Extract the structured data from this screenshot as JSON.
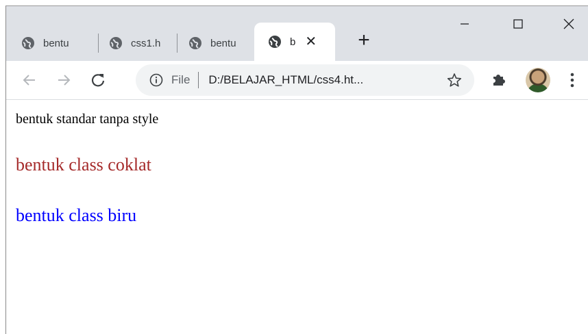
{
  "browser": {
    "tabs": [
      {
        "title": "bentu"
      },
      {
        "title": "css1.h"
      },
      {
        "title": "bentu"
      },
      {
        "title": "b",
        "active": true
      }
    ],
    "new_tab_symbol": "+",
    "close_tab_symbol": "✕",
    "window_controls": {
      "minimize_icon": "minimize-icon",
      "maximize_icon": "maximize-icon",
      "close_icon": "window-close-icon"
    },
    "nav_icons": [
      "back-arrow-icon",
      "forward-arrow-icon",
      "reload-icon"
    ],
    "address_bar": {
      "scheme_label": "File",
      "url": "D:/BELAJAR_HTML/css4.ht..."
    },
    "toolbar_icons": [
      "star-icon",
      "extensions-puzzle-icon",
      "profile-avatar",
      "menu-kebab-icon"
    ]
  },
  "page": {
    "paragraphs": [
      {
        "text": "bentuk standar tanpa style",
        "color": "#000000"
      },
      {
        "text": "bentuk class coklat",
        "color": "#a52a2a"
      },
      {
        "text": "bentuk class biru",
        "color": "#0000ff"
      }
    ]
  }
}
